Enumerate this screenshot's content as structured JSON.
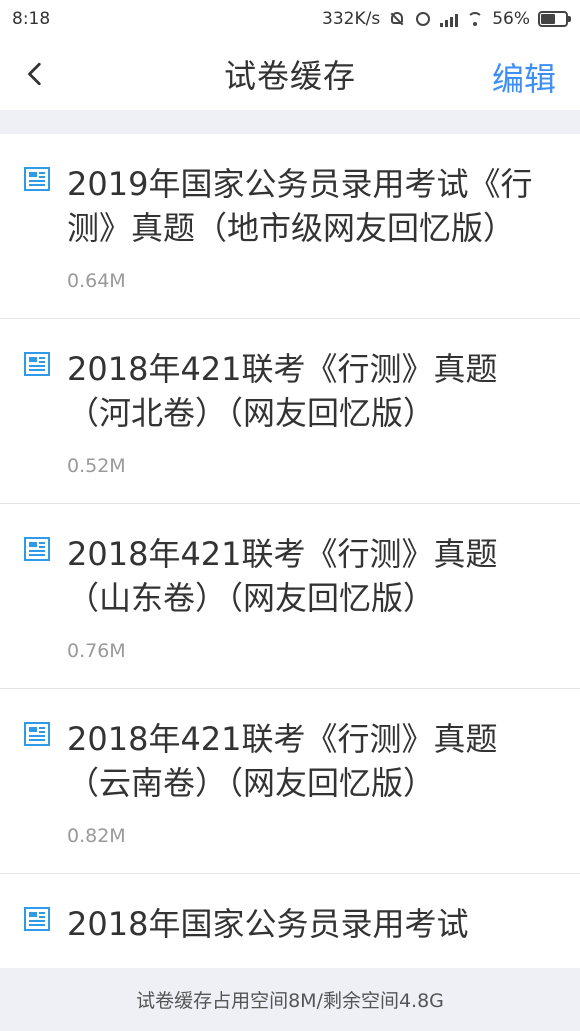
{
  "status_bar": {
    "time": "8:18",
    "network_speed": "332K/s",
    "battery_percent": "56%",
    "icons": [
      "mute-bell-icon",
      "alarm-icon",
      "signal-icon",
      "wifi-icon",
      "battery-charging-icon"
    ]
  },
  "nav": {
    "back_icon": "chevron-left-icon",
    "title": "试卷缓存",
    "edit_label": "编辑"
  },
  "items": [
    {
      "title": "2019年国家公务员录用考试《行测》真题（地市级网友回忆版）",
      "size": "0.64M"
    },
    {
      "title": "2018年421联考《行测》真题（河北卷）（网友回忆版）",
      "size": "0.52M"
    },
    {
      "title": "2018年421联考《行测》真题（山东卷）（网友回忆版）",
      "size": "0.76M"
    },
    {
      "title": "2018年421联考《行测》真题（云南卷）（网友回忆版）",
      "size": "0.82M"
    },
    {
      "title": "2018年国家公务员录用考试",
      "size": ""
    }
  ],
  "footer": {
    "storage_text": "试卷缓存占用空间8M/剩余空间4.8G"
  },
  "colors": {
    "accent": "#3d8ef5",
    "doc_icon": "#2f9be8",
    "background_strip": "#eef0f6"
  }
}
